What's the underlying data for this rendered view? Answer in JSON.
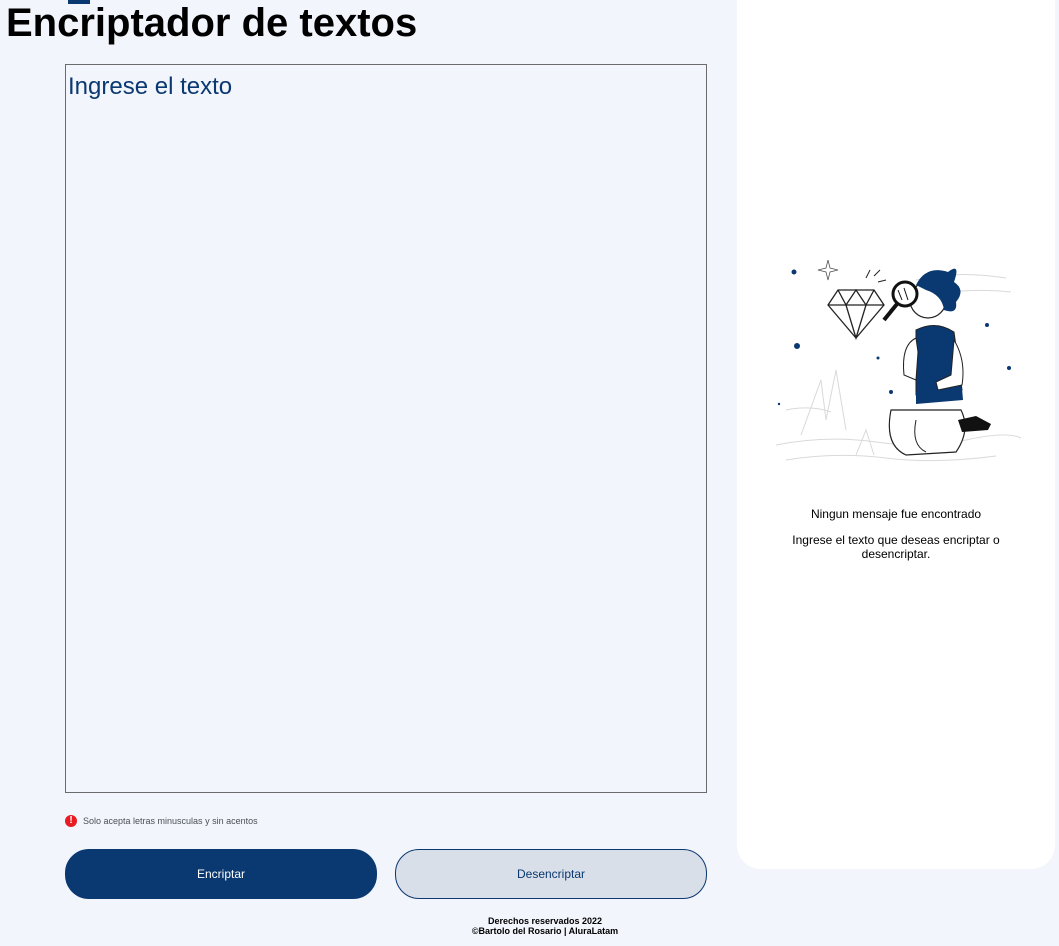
{
  "header": {
    "title": "Encriptador de textos"
  },
  "input": {
    "placeholder": "Ingrese el texto",
    "value": ""
  },
  "warning": {
    "icon": "exclamation-circle-icon",
    "icon_glyph": "!",
    "text": "Solo acepta letras minusculas y sin acentos"
  },
  "buttons": {
    "encrypt_label": "Encriptar",
    "decrypt_label": "Desencriptar"
  },
  "footer": {
    "line1": "Derechos reservados 2022",
    "line2": "©Bartolo del Rosario | AluraLatam"
  },
  "result": {
    "illustration_icon": "person-magnifying-glass-illustration",
    "title": "Ningun mensaje fue encontrado",
    "hint": "Ingrese el texto que deseas encriptar o desencriptar."
  },
  "colors": {
    "page_background": "#f3f5fc",
    "primary": "#0a3871",
    "secondary_button": "#d8dfe8",
    "warning": "#e81b23",
    "panel": "#ffffff"
  }
}
